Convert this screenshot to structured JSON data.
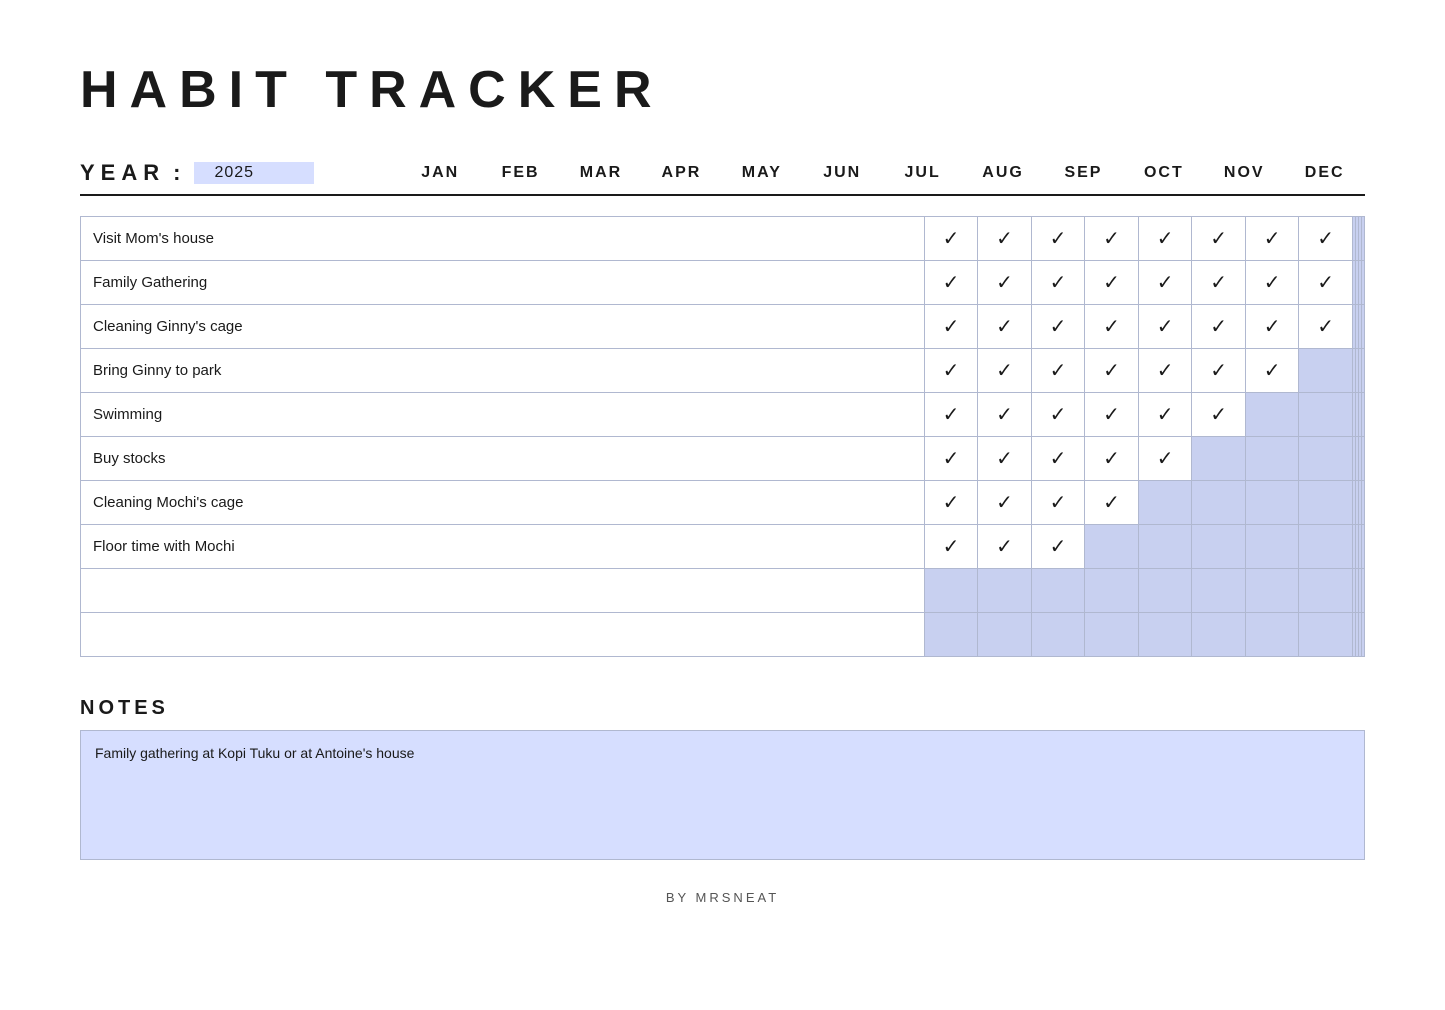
{
  "title": "HABIT TRACKER",
  "year_label": "YEAR",
  "year_colon": ":",
  "year_value": "2025",
  "months": [
    "JAN",
    "FEB",
    "MAR",
    "APR",
    "MAY",
    "JUN",
    "JUL",
    "AUG",
    "SEP",
    "OCT",
    "NOV",
    "DEC"
  ],
  "checkmark": "✓",
  "habits": [
    {
      "name": "Visit Mom's house",
      "checks": [
        true,
        true,
        true,
        true,
        true,
        true,
        true,
        true,
        false,
        false,
        false,
        false
      ]
    },
    {
      "name": "Family Gathering",
      "checks": [
        true,
        true,
        true,
        true,
        true,
        true,
        true,
        true,
        false,
        false,
        false,
        false
      ]
    },
    {
      "name": "Cleaning Ginny's cage",
      "checks": [
        true,
        true,
        true,
        true,
        true,
        true,
        true,
        true,
        false,
        false,
        false,
        false
      ]
    },
    {
      "name": "Bring Ginny to park",
      "checks": [
        true,
        true,
        true,
        true,
        true,
        true,
        true,
        false,
        false,
        false,
        false,
        false
      ]
    },
    {
      "name": "Swimming",
      "checks": [
        true,
        true,
        true,
        true,
        true,
        true,
        false,
        false,
        false,
        false,
        false,
        false
      ]
    },
    {
      "name": "Buy stocks",
      "checks": [
        true,
        true,
        true,
        true,
        true,
        false,
        false,
        false,
        false,
        false,
        false,
        false
      ]
    },
    {
      "name": "Cleaning Mochi's cage",
      "checks": [
        true,
        true,
        true,
        true,
        false,
        false,
        false,
        false,
        false,
        false,
        false,
        false
      ]
    },
    {
      "name": "Floor time with Mochi",
      "checks": [
        true,
        true,
        true,
        false,
        false,
        false,
        false,
        false,
        false,
        false,
        false,
        false
      ]
    },
    {
      "name": "",
      "checks": [
        false,
        false,
        false,
        false,
        false,
        false,
        false,
        false,
        false,
        false,
        false,
        false
      ]
    },
    {
      "name": "",
      "checks": [
        false,
        false,
        false,
        false,
        false,
        false,
        false,
        false,
        false,
        false,
        false,
        false
      ]
    }
  ],
  "notes_title": "NOTES",
  "notes_content": "Family gathering at Kopi Tuku or at Antoine's house",
  "footer": "BY MRSNEAT"
}
